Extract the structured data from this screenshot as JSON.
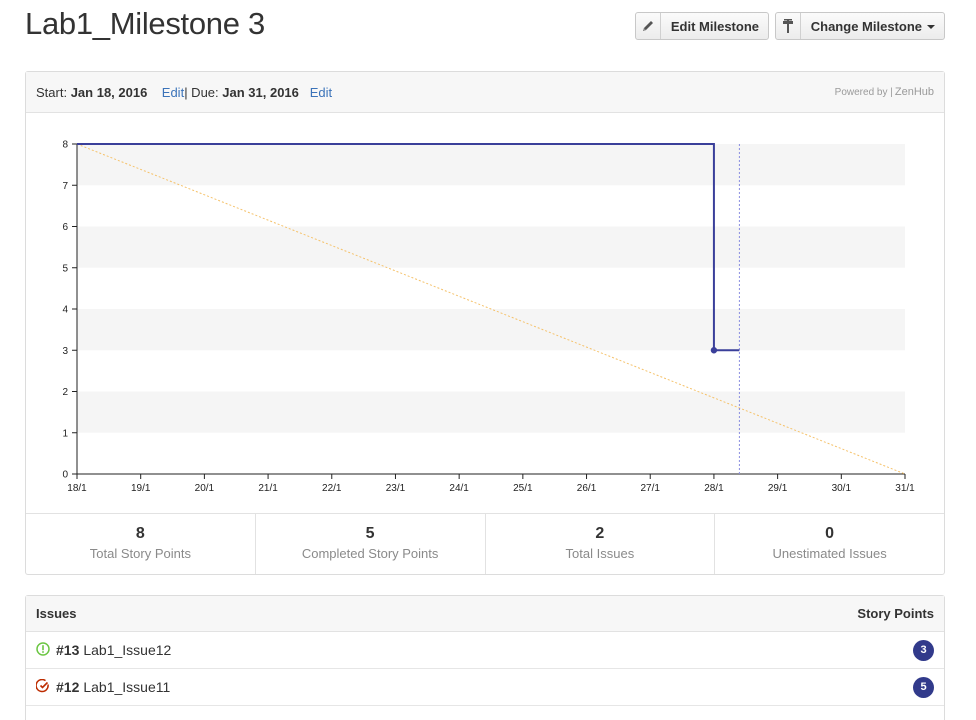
{
  "header": {
    "title": "Lab1_Milestone 3",
    "edit_button": "Edit Milestone",
    "change_button": "Change Milestone"
  },
  "milestone": {
    "start_label": "Start:",
    "start_date": "Jan 18, 2016",
    "edit_start": "Edit",
    "separator": " | Due:",
    "due_date": "Jan 31, 2016",
    "edit_due": "Edit",
    "powered_by": "Powered by |",
    "powered_brand": "ZenHub"
  },
  "chart_data": {
    "type": "line",
    "x_labels": [
      "18/1",
      "19/1",
      "20/1",
      "21/1",
      "22/1",
      "23/1",
      "24/1",
      "25/1",
      "26/1",
      "27/1",
      "28/1",
      "29/1",
      "30/1",
      "31/1"
    ],
    "y_ticks": [
      0,
      1,
      2,
      3,
      4,
      5,
      6,
      7,
      8
    ],
    "ylim": [
      0,
      8
    ],
    "series": [
      {
        "color": "#3a3f9a",
        "style": "step",
        "points": [
          [
            0,
            8
          ],
          [
            10,
            8
          ],
          [
            10,
            3
          ],
          [
            10.4,
            3
          ]
        ],
        "marker_at": [
          10,
          3
        ]
      },
      {
        "color": "#f5c26b",
        "style": "dotted",
        "points": [
          [
            0,
            8
          ],
          [
            13,
            0
          ]
        ]
      }
    ],
    "today_marker_x": 10.4,
    "today_color": "#8a8ee0",
    "band_color": "#f5f5f5"
  },
  "stats": [
    {
      "value": "8",
      "label": "Total Story Points"
    },
    {
      "value": "5",
      "label": "Completed Story Points"
    },
    {
      "value": "2",
      "label": "Total Issues"
    },
    {
      "value": "0",
      "label": "Unestimated Issues"
    }
  ],
  "issues": {
    "header_left": "Issues",
    "header_right": "Story Points",
    "rows": [
      {
        "number": "#13",
        "title": "Lab1_Issue12",
        "points": "3",
        "status_icon": "open-issue-icon",
        "icon_color": "#6cc644"
      },
      {
        "number": "#12",
        "title": "Lab1_Issue11",
        "points": "5",
        "status_icon": "closed-issue-icon",
        "icon_color": "#bd2c00"
      }
    ]
  }
}
